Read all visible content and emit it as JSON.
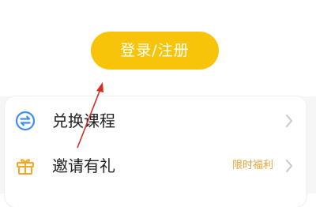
{
  "login": {
    "label": "登录/注册"
  },
  "menu": {
    "items": [
      {
        "label": "兑换课程",
        "icon": "exchange-icon",
        "badge": ""
      },
      {
        "label": "邀请有礼",
        "icon": "gift-icon",
        "badge": "限时福利"
      }
    ]
  },
  "colors": {
    "accent": "#f8c40a",
    "icon_blue": "#3d8cf0",
    "icon_orange": "#f5a623",
    "badge_text": "#e0a33a",
    "annotation": "#d62d20"
  }
}
